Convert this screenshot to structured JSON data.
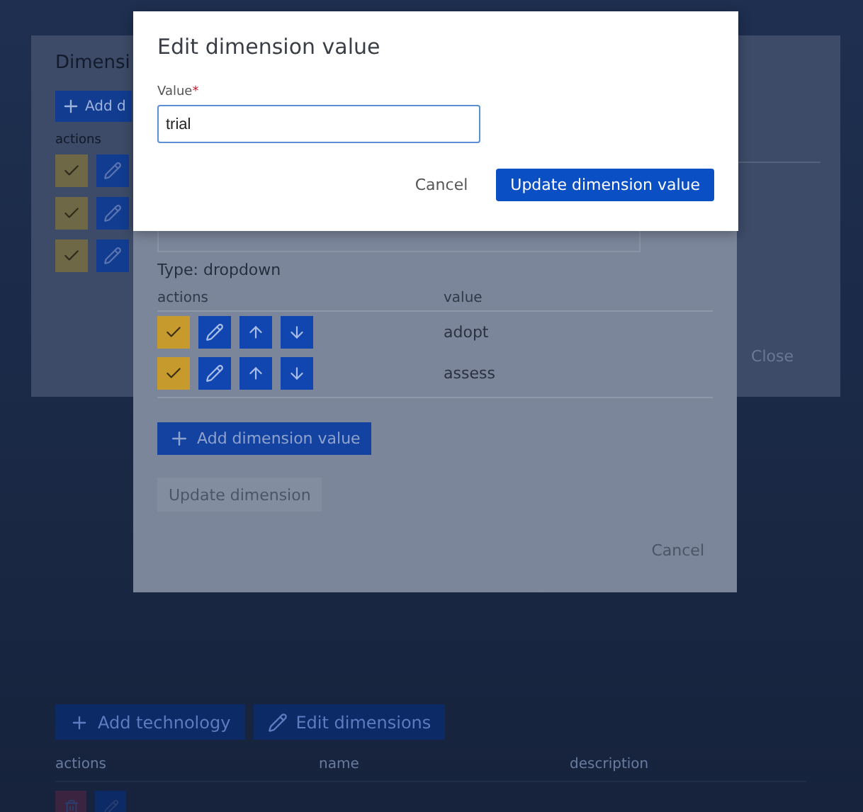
{
  "background": {
    "buttons": [
      {
        "label": "Add technology",
        "kind": "add"
      },
      {
        "label": "Edit dimensions",
        "kind": "edit"
      }
    ],
    "columns": [
      "actions",
      "name",
      "description"
    ],
    "rows": [
      {
        "actions": [
          {
            "kind": "delete"
          },
          {
            "kind": "edit"
          }
        ]
      }
    ]
  },
  "dimensions_dialog": {
    "title": "Dimensi",
    "add_button": "Add d",
    "columns": [
      "actions"
    ],
    "rows": [
      {
        "actions": [
          {
            "kind": "check"
          },
          {
            "kind": "edit"
          }
        ]
      },
      {
        "actions": [
          {
            "kind": "check"
          },
          {
            "kind": "edit"
          }
        ]
      },
      {
        "actions": [
          {
            "kind": "check"
          },
          {
            "kind": "edit"
          }
        ]
      }
    ],
    "close": "Close"
  },
  "edit_dimension_dialog": {
    "type_label": "Type: dropdown",
    "columns": [
      "actions",
      "value"
    ],
    "rows": [
      {
        "actions": [
          {
            "kind": "check"
          },
          {
            "kind": "edit"
          },
          {
            "kind": "up"
          },
          {
            "kind": "down"
          }
        ],
        "value": "adopt"
      },
      {
        "actions": [
          {
            "kind": "check"
          },
          {
            "kind": "edit"
          },
          {
            "kind": "up"
          },
          {
            "kind": "down"
          }
        ],
        "value": "assess"
      }
    ],
    "add_button": "Add dimension value",
    "update_button": {
      "label": "Update dimension",
      "disabled": true
    },
    "cancel": "Cancel"
  },
  "edit_value_dialog": {
    "title": "Edit dimension value",
    "field": {
      "label": "Value",
      "required_mark": "*",
      "value": "trial"
    },
    "cancel": "Cancel",
    "submit": "Update dimension value"
  }
}
